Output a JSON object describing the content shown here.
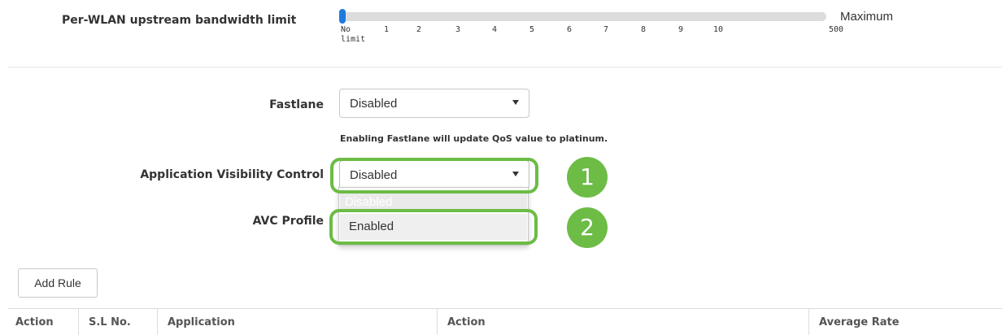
{
  "bandwidth": {
    "label": "Per-WLAN upstream bandwidth limit",
    "slider_value_fraction": 0,
    "ticks": [
      "No limit",
      "1",
      "2",
      "3",
      "4",
      "5",
      "6",
      "7",
      "8",
      "9",
      "10",
      "500"
    ],
    "max_label": "Maximum"
  },
  "fastlane": {
    "label": "Fastlane",
    "value": "Disabled",
    "note": "Enabling Fastlane will update QoS value to platinum."
  },
  "avc": {
    "label": "Application Visibility Control",
    "value": "Disabled",
    "options": [
      "Disabled",
      "Enabled"
    ]
  },
  "avc_profile": {
    "label": "AVC Profile"
  },
  "callouts": [
    "1",
    "2"
  ],
  "add_rule_label": "Add Rule",
  "table": {
    "columns": [
      "Action",
      "S.L No.",
      "Application",
      "Action",
      "Average Rate"
    ]
  },
  "colors": {
    "highlight": "#6cbc46",
    "slider": "#2a7ae2"
  }
}
